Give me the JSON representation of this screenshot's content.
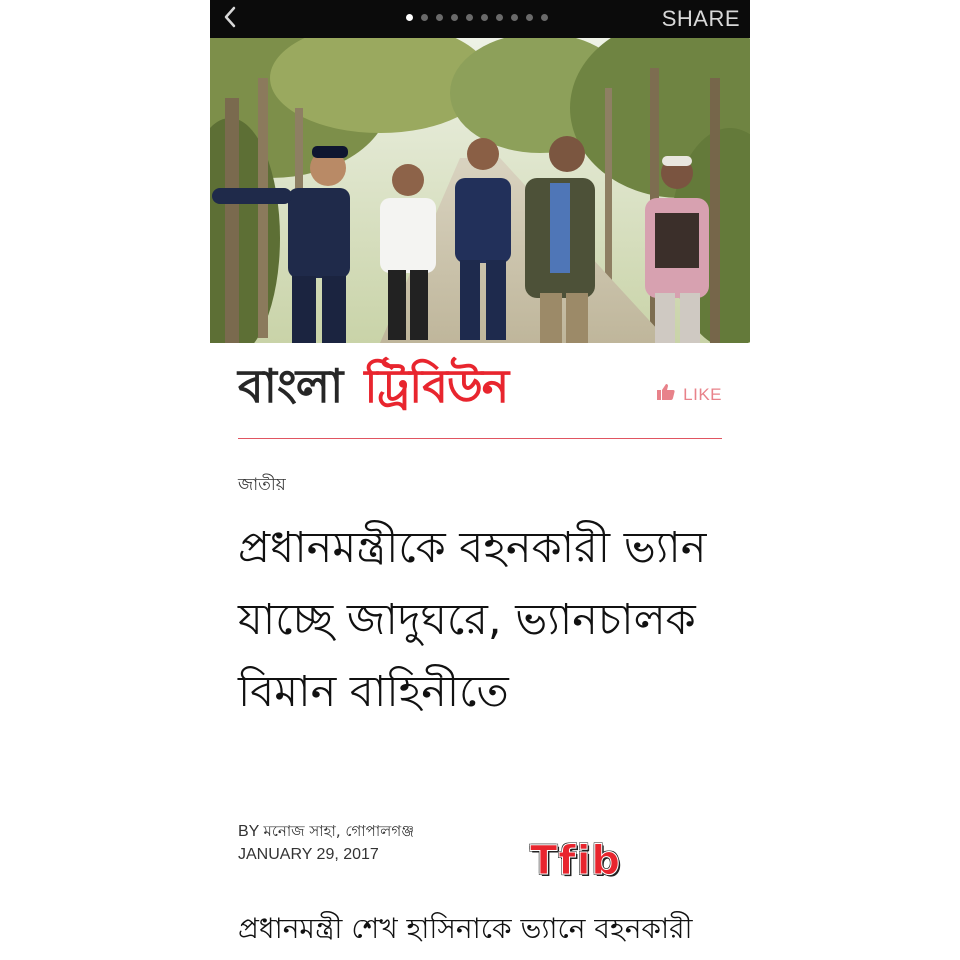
{
  "topbar": {
    "share_label": "SHARE",
    "page_count": 10,
    "active_page": 1
  },
  "masthead": {
    "logo_bangla": "বাংলা",
    "logo_tribune": "ট্রিবিউন",
    "like_label": "LIKE",
    "brand_color": "#e8252e"
  },
  "article": {
    "category": "জাতীয়",
    "headline": "প্রধানমন্ত্রীকে বহনকারী ভ্যান যাচ্ছে জাদুঘরে, ভ্যানচালক বিমান বাহিনীতে",
    "byline_prefix": "BY",
    "author": "মনোজ সাহা, গোপালগঞ্জ",
    "date": "JANUARY 29, 2017",
    "body_first_line": "প্রধানমন্ত্রী শেখ হাসিনাকে ভ্যানে বহনকারী"
  },
  "watermark": "Tfib"
}
